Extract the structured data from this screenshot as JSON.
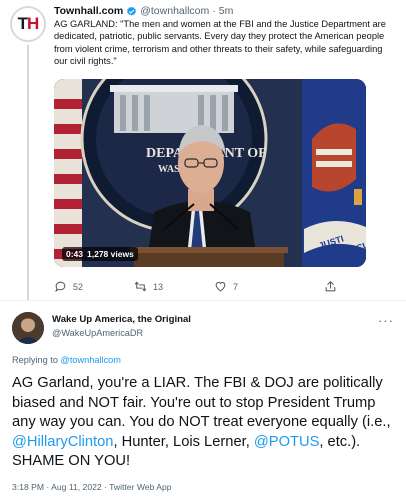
{
  "parent_tweet": {
    "author_name": "Townhall.com",
    "handle": "@townhallcom",
    "separator": "·",
    "time": "5m",
    "text": "AG GARLAND: \"The men and women at the FBI and the Justice Department are dedicated, patriotic, public servants. Every day they protect the American people from violent crime, terrorism and other threats to their safety, while safeguarding our civil rights.\"",
    "video": {
      "duration": "0:43",
      "views": "1,278 views",
      "seal_line1": "DEPARTMENT OF",
      "seal_line2": "WASHINGT"
    },
    "actions": {
      "replies": "52",
      "retweets": "13",
      "likes": "7"
    }
  },
  "reply_tweet": {
    "author_name": "Wake Up America, the Original",
    "handle": "@WakeUpAmericaDR",
    "replying_prefix": "Replying to",
    "replying_to": "@townhallcom",
    "text_part1": "AG Garland, you're a LIAR.  The FBI & DOJ are politically biased and NOT fair.  You're out to stop President Trump any way you can.  You do NOT treat everyone equally (i.e., ",
    "mention1": "@HillaryClinton",
    "text_part2": ", Hunter, Lois Lerner, ",
    "mention2": "@POTUS",
    "text_part3": ", etc.).  SHAME ON YOU!",
    "timestamp": "3:18 PM · Aug 11, 2022 · Twitter Web App"
  },
  "colors": {
    "accent": "#1d9bf0",
    "muted": "#536471",
    "text": "#0f1419"
  }
}
